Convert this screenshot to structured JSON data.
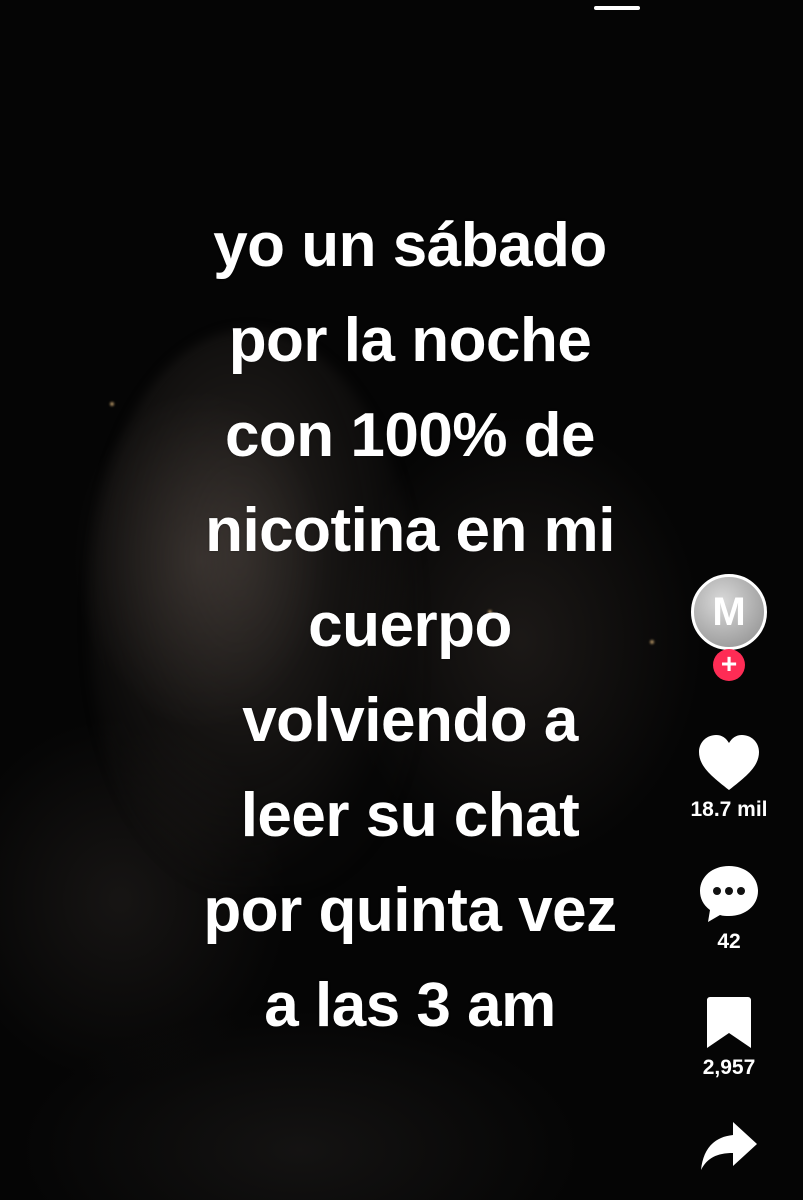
{
  "caption": {
    "lines": [
      "yo un sábado",
      "por la noche",
      "con 100% de",
      "nicotina en mi",
      "cuerpo",
      "volviendo a",
      "leer su chat",
      "por quinta vez",
      "a las 3 am"
    ]
  },
  "creator": {
    "avatar_initial": "M",
    "follow_symbol": "+"
  },
  "actions": {
    "likes": "18.7 mil",
    "comments": "42",
    "saves": "2,957"
  },
  "icons": {
    "like": "heart-icon",
    "comment": "comment-bubble-icon",
    "save": "bookmark-icon",
    "share": "share-arrow-icon"
  },
  "colors": {
    "accent": "#fe2c55",
    "text": "#ffffff",
    "background": "#000000"
  }
}
